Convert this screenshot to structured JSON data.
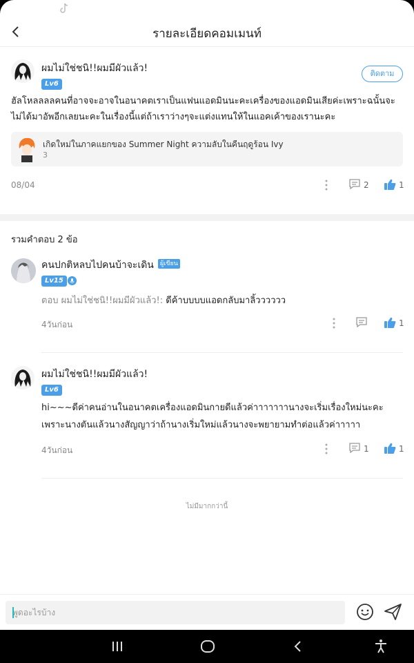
{
  "header": {
    "title": "รายละเอียดคอมเมนท์"
  },
  "main_comment": {
    "username": "ผมไม่ใช่ชนิ!!ผมมีผัวแล้ว!",
    "level": "Lv6",
    "follow_label": "ติดตาม",
    "text": "ฮัลโหลลลลคนที่อาจจะอาจในอนาคตเราเป็นแฟนแอดมินนะคะเครื่องของแอดมินเสียค่ะเพราะฉนั้นจะไม่ได้มาอัพอีกเลยนะคะในเรื่องนี้แต่ถ้าเราว่างๆจะแต่งแทนให้ในแอคเค้าของเรานะคะ",
    "ref_title": "เกิดใหม่ในภาคแยกของ Summer Night ความลับในคืนฤดูร้อน Ivy",
    "ref_count": "3",
    "date": "08/04",
    "comment_count": "2",
    "like_count": "1"
  },
  "replies": {
    "title": "รวมคำตอบ 2 ข้อ",
    "items": [
      {
        "username": "คนปกติหลบไปคนบ้าจะเดิน",
        "tag": "ผู้เขียน",
        "level": "Lv15",
        "reply_prefix": "ตอบ ผมไม่ใช่ชนิ!!ผมมีผัวแล้ว!:",
        "text": "ดีค้าบบบบแอดกลับมาลิ้วววววว",
        "time": "4วันก่อน",
        "like_count": "1"
      },
      {
        "username": "ผมไม่ใช่ชนิ!!ผมมีผัวแล้ว!",
        "level": "Lv6",
        "text": "hi~~~ดีค่าคนอ่านในอนาคตเครื่องแอดมินกายดีแล้วค่าาาาาาานางจะเริ่มเรื่องใหม่นะคะเพราะนางตันแล้วนางสัญญาว่าถ้านางเริ่มใหม่แล้วนางจะพยายามทำต่อแล้วค่าาาาา",
        "time": "4วันก่อน",
        "comment_count": "1",
        "like_count": "1"
      }
    ],
    "no_more": "ไม่มีมากกว่านี้"
  },
  "input": {
    "placeholder": "พูดอะไรบ้าง"
  },
  "colors": {
    "accent": "#4a9fe8",
    "background": "#ffffff",
    "separator": "#f2f2f2"
  }
}
